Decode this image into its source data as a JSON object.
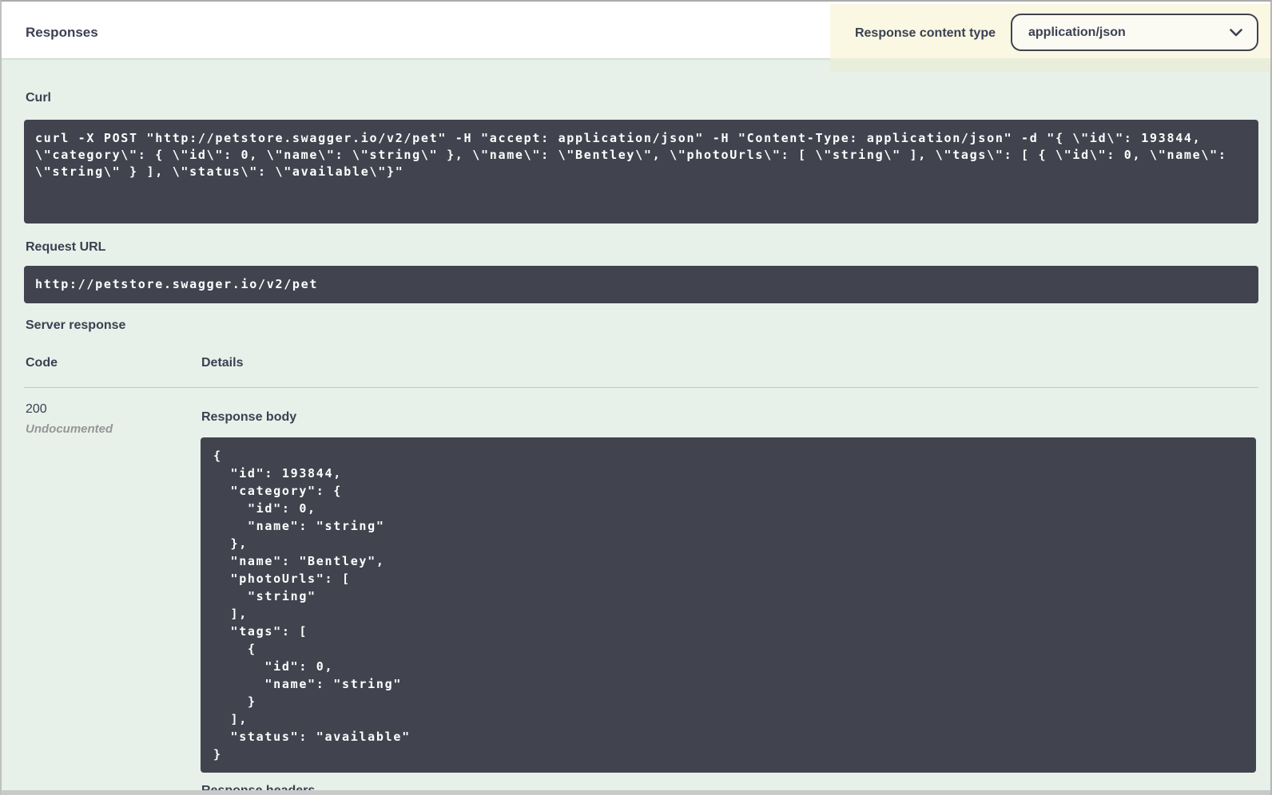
{
  "section": {
    "title": "Responses"
  },
  "content_type": {
    "label": "Response content type",
    "value": "application/json"
  },
  "curl": {
    "label": "Curl",
    "command": "curl -X POST \"http://petstore.swagger.io/v2/pet\" -H \"accept: application/json\" -H \"Content-Type: application/json\" -d \"{ \\\"id\\\": 193844, \\\"category\\\": { \\\"id\\\": 0, \\\"name\\\": \\\"string\\\" }, \\\"name\\\": \\\"Bentley\\\", \\\"photoUrls\\\": [ \\\"string\\\" ], \\\"tags\\\": [ { \\\"id\\\": 0, \\\"name\\\": \\\"string\\\" } ], \\\"status\\\": \\\"available\\\"}\""
  },
  "request_url": {
    "label": "Request URL",
    "value": "http://petstore.swagger.io/v2/pet"
  },
  "server_response": {
    "title": "Server response",
    "columns": {
      "code": "Code",
      "details": "Details"
    },
    "row": {
      "code": "200",
      "note": "Undocumented",
      "response_body_label": "Response body",
      "response_body": "{\n  \"id\": 193844,\n  \"category\": {\n    \"id\": 0,\n    \"name\": \"string\"\n  },\n  \"name\": \"Bentley\",\n  \"photoUrls\": [\n    \"string\"\n  ],\n  \"tags\": [\n    {\n      \"id\": 0,\n      \"name\": \"string\"\n    }\n  ],\n  \"status\": \"available\"\n}",
      "response_headers_label": "Response headers"
    }
  },
  "colors": {
    "code_background": "#41444e",
    "section_background": "#e7f1ea",
    "highlight_yellow": "#faf7e3",
    "text": "#3b4151"
  }
}
